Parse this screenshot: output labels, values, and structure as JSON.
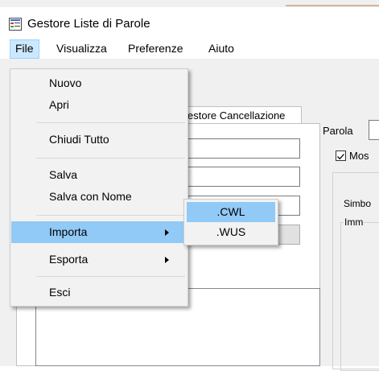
{
  "window": {
    "title": "Gestore Liste di Parole"
  },
  "menubar": {
    "items": [
      {
        "label": "File"
      },
      {
        "label": "Visualizza"
      },
      {
        "label": "Preferenze"
      },
      {
        "label": "Aiuto"
      }
    ]
  },
  "tab": {
    "label": "estore Cancellazione"
  },
  "right": {
    "word_label": "Parola",
    "show_checkbox_label": "Mos",
    "symbol_label": "Simbo",
    "imm_group_label": "Imm"
  },
  "file_menu": {
    "items": [
      {
        "label": "Nuovo"
      },
      {
        "label": "Apri"
      },
      {
        "label": "Chiudi Tutto"
      },
      {
        "label": "Salva"
      },
      {
        "label": "Salva con Nome"
      },
      {
        "label": "Importa",
        "submenu": true,
        "highlighted": true
      },
      {
        "label": "Esporta",
        "submenu": true
      },
      {
        "label": "Esci"
      }
    ]
  },
  "import_submenu": {
    "items": [
      {
        "label": ".CWL",
        "highlighted": true
      },
      {
        "label": ".WUS"
      }
    ]
  },
  "colors": {
    "highlight": "#91c9f7",
    "menu_active": "#cce8ff",
    "menu_bg": "#f2f2f2"
  }
}
